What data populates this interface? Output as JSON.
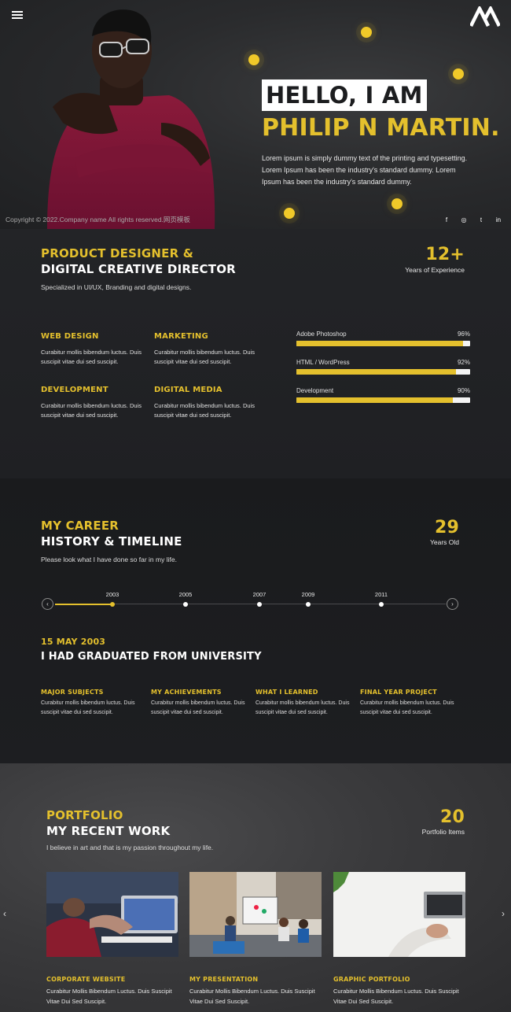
{
  "hero": {
    "hello": "HELLO, I AM",
    "name": "PHILIP N MARTIN.",
    "description": "Lorem ipsum is simply dummy text of the printing and typesetting. Lorem Ipsum has been the industry's standard dummy. Lorem Ipsum has been the industry's standard dummy.",
    "copyright": "Copyright © 2022.Company name All rights reserved.网页模板",
    "socials": [
      "f",
      "◎",
      "t",
      "in"
    ]
  },
  "about": {
    "title_line1": "PRODUCT DESIGNER &",
    "title_line2": "DIGITAL CREATIVE DIRECTOR",
    "subtitle": "Specialized in UI/UX, Branding and digital designs.",
    "stat_value": "12+",
    "stat_label": "Years of Experience",
    "services": [
      {
        "title": "WEB DESIGN",
        "text": "Curabitur mollis bibendum luctus. Duis suscipit vitae dui sed suscipit."
      },
      {
        "title": "MARKETING",
        "text": "Curabitur mollis bibendum luctus. Duis suscipit vitae dui sed suscipit."
      },
      {
        "title": "DEVELOPMENT",
        "text": "Curabitur mollis bibendum luctus. Duis suscipit vitae dui sed suscipit."
      },
      {
        "title": "DIGITAL MEDIA",
        "text": "Curabitur mollis bibendum luctus. Duis suscipit vitae dui sed suscipit."
      }
    ],
    "skills": [
      {
        "label": "Adobe Photoshop",
        "percent_text": "96%",
        "percent": 96
      },
      {
        "label": "HTML / WordPress",
        "percent_text": "92%",
        "percent": 92
      },
      {
        "label": "Development",
        "percent_text": "90%",
        "percent": 90
      }
    ]
  },
  "career": {
    "title_line1": "MY CAREER",
    "title_line2": "HISTORY & TIMELINE",
    "subtitle": "Please look what I have done so far in my life.",
    "stat_value": "29",
    "stat_label": "Years Old",
    "years": [
      "2003",
      "2005",
      "2007",
      "2009",
      "2011"
    ],
    "active_year": "2003",
    "event_date": "15 MAY 2003",
    "event_title": "I HAD GRADUATED FROM UNIVERSITY",
    "columns": [
      {
        "title": "MAJOR SUBJECTS",
        "text": "Curabitur mollis bibendum luctus. Duis suscipit vitae dui sed suscipit."
      },
      {
        "title": "MY ACHIEVEMENTS",
        "text": "Curabitur mollis bibendum luctus. Duis suscipit vitae dui sed suscipit."
      },
      {
        "title": "WHAT I LEARNED",
        "text": "Curabitur mollis bibendum luctus. Duis suscipit vitae dui sed suscipit."
      },
      {
        "title": "FINAL YEAR PROJECT",
        "text": "Curabitur mollis bibendum luctus. Duis suscipit vitae dui sed suscipit."
      }
    ]
  },
  "portfolio": {
    "title_line1": "PORTFOLIO",
    "title_line2": "MY RECENT WORK",
    "subtitle": "I believe in art and that is my passion throughout my life.",
    "stat_value": "20",
    "stat_label": "Portfolio Items",
    "items": [
      {
        "title": "CORPORATE WEBSITE",
        "text": "Curabitur Mollis Bibendum Luctus. Duis Suscipit Vitae Dui Sed Suscipit."
      },
      {
        "title": "MY PRESENTATION",
        "text": "Curabitur Mollis Bibendum Luctus. Duis Suscipit Vitae Dui Sed Suscipit."
      },
      {
        "title": "GRAPHIC PORTFOLIO",
        "text": "Curabitur Mollis Bibendum Luctus. Duis Suscipit Vitae Dui Sed Suscipit."
      }
    ],
    "prev_arrow": "‹",
    "next_arrow": "›"
  },
  "colors": {
    "accent": "#e4c02d",
    "background": "#1c1d1f",
    "text": "#ffffff"
  },
  "icons": {
    "menu": "hamburger-menu-icon",
    "logo": "logo-mark-icon",
    "prev": "chevron-left-icon",
    "next": "chevron-right-icon"
  }
}
